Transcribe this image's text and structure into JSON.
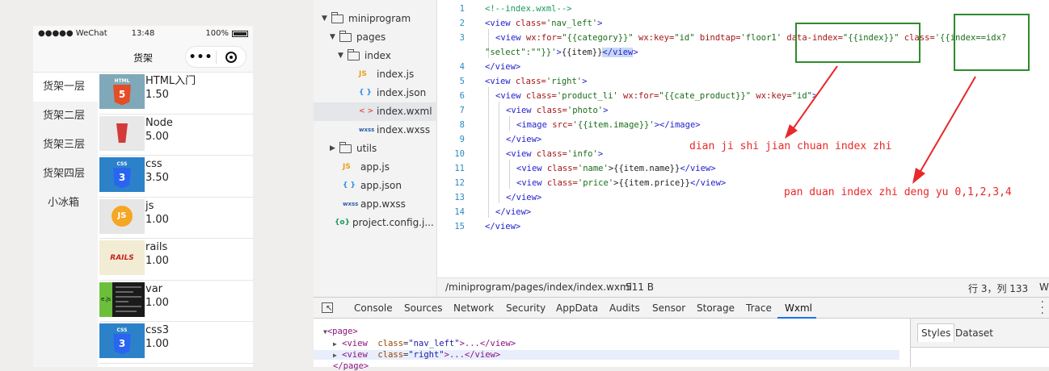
{
  "phone": {
    "carrier": "●●●●● WeChat",
    "time": "13:48",
    "battery": "100%",
    "nav_title": "货架",
    "capsule_more": "•••",
    "nav_items": [
      "货架一层",
      "货架二层",
      "货架三层",
      "货架四层",
      "小冰箱"
    ],
    "products": [
      {
        "name": "HTML入门",
        "price": "1.50",
        "photo": "html"
      },
      {
        "name": "Node",
        "price": "5.00",
        "photo": "node"
      },
      {
        "name": "css",
        "price": "3.50",
        "photo": "css"
      },
      {
        "name": "js",
        "price": "1.00",
        "photo": "js"
      },
      {
        "name": "rails",
        "price": "1.00",
        "photo": "rails"
      },
      {
        "name": "var",
        "price": "1.00",
        "photo": "var"
      },
      {
        "name": "css3",
        "price": "1.00",
        "photo": "css"
      }
    ],
    "photo_labels": {
      "html": "HTML",
      "html_num": "5",
      "css": "CSS",
      "css_num": "3",
      "js": "JS",
      "rails": "RAILS",
      "var": "e.js"
    }
  },
  "tree": {
    "items": [
      {
        "label": "miniprogram",
        "type": "folder",
        "arrow": "▼"
      },
      {
        "label": "pages",
        "type": "folder",
        "arrow": "▼"
      },
      {
        "label": "index",
        "type": "folder",
        "arrow": "▼"
      },
      {
        "label": "index.js",
        "type": "js",
        "icon": "JS"
      },
      {
        "label": "index.json",
        "type": "json",
        "icon": "{ }"
      },
      {
        "label": "index.wxml",
        "type": "wxml",
        "icon": "< >"
      },
      {
        "label": "index.wxss",
        "type": "wxss",
        "icon": "wxss"
      },
      {
        "label": "utils",
        "type": "folder",
        "arrow": "▶"
      },
      {
        "label": "app.js",
        "type": "js",
        "icon": "JS"
      },
      {
        "label": "app.json",
        "type": "json",
        "icon": "{ }"
      },
      {
        "label": "app.wxss",
        "type": "wxss",
        "icon": "wxss"
      },
      {
        "label": "project.config.j...",
        "type": "cfg",
        "icon": "{o}"
      }
    ]
  },
  "editor": {
    "line_numbers": [
      "1",
      "2",
      "3",
      "",
      "4",
      "5",
      "6",
      "7",
      "8",
      "9",
      "10",
      "11",
      "12",
      "13",
      "14",
      "15"
    ],
    "code": {
      "l1": "<!--index.wxml-->",
      "l2_tag": "<view",
      "l2_attr": " class=",
      "l2_str": "'nav_left'",
      "l2_end": ">",
      "l3_tag": "<view",
      "l3_a1": " wx:for=",
      "l3_s1": "\"{{category}}\"",
      "l3_a2": " wx:key=",
      "l3_s2": "\"id\"",
      "l3_a3": " bindtap=",
      "l3_s3": "'floor1'",
      "l3_a4": " data-index=",
      "l3_s4": "\"{{index}}\"",
      "l3_a5": " class=",
      "l3_s5": "'{{index==idx?",
      "l3b_s": "\"select\":\"\"}}'",
      "l3b_gt": ">",
      "l3b_txt": "{{item}}",
      "l3b_end": "</view",
      "l3b_gt2": ">",
      "l4": "</view>",
      "l5_tag": "<view",
      "l5_attr": " class=",
      "l5_str": "'right'",
      "l5_end": ">",
      "l6_tag": "<view",
      "l6_a1": " class=",
      "l6_s1": "'product_li'",
      "l6_a2": " wx:for=",
      "l6_s2": "\"{{cate_product}}\"",
      "l6_a3": " wx:key=",
      "l6_s3": "\"id\"",
      "l6_end": ">",
      "l7_tag": "<view",
      "l7_attr": " class=",
      "l7_str": "'photo'",
      "l7_end": ">",
      "l8_tag": "<image",
      "l8_attr": " src=",
      "l8_str": "'{{item.image}}'",
      "l8_end": "></image>",
      "l9": "</view>",
      "l10_tag": "<view",
      "l10_attr": " class=",
      "l10_str": "'info'",
      "l10_end": ">",
      "l11_tag": "<view",
      "l11_attr": " class=",
      "l11_str": "'name'",
      "l11_mid": ">{{item.name}}",
      "l11_end": "</view>",
      "l12_tag": "<view",
      "l12_attr": " class=",
      "l12_str": "'price'",
      "l12_mid": ">{{item.price}}",
      "l12_end": "</view>",
      "l13": "</view>",
      "l14": "</view>",
      "l15": "</view>"
    },
    "annotations": {
      "a1": "dian ji shi jian chuan index zhi",
      "a2": "pan duan index zhi deng yu 0,1,2,3,4"
    },
    "status_path": "/miniprogram/pages/index/index.wxml",
    "status_size": "511 B",
    "status_pos": "行 3，列 133",
    "status_w": "W"
  },
  "devtools": {
    "tabs": [
      "Console",
      "Sources",
      "Network",
      "Security",
      "AppData",
      "Audits",
      "Sensor",
      "Storage",
      "Trace",
      "Wxml"
    ],
    "active_tab": "Wxml",
    "xml": {
      "page_open": "<page>",
      "row1_tag": "<view",
      "row1_attr": "class",
      "row1_val": "\"nav_left\"",
      "row1_rest": ">...</view>",
      "row2_tag": "<view",
      "row2_attr": "class",
      "row2_val": "\"right\"",
      "row2_rest": ">...</view>",
      "row3": "</page>"
    },
    "side_tabs": [
      "Styles",
      "Dataset"
    ]
  },
  "colors": {
    "annotation": "#e8282a",
    "box": "#2e8b2e",
    "accent": "#1a73e8"
  }
}
